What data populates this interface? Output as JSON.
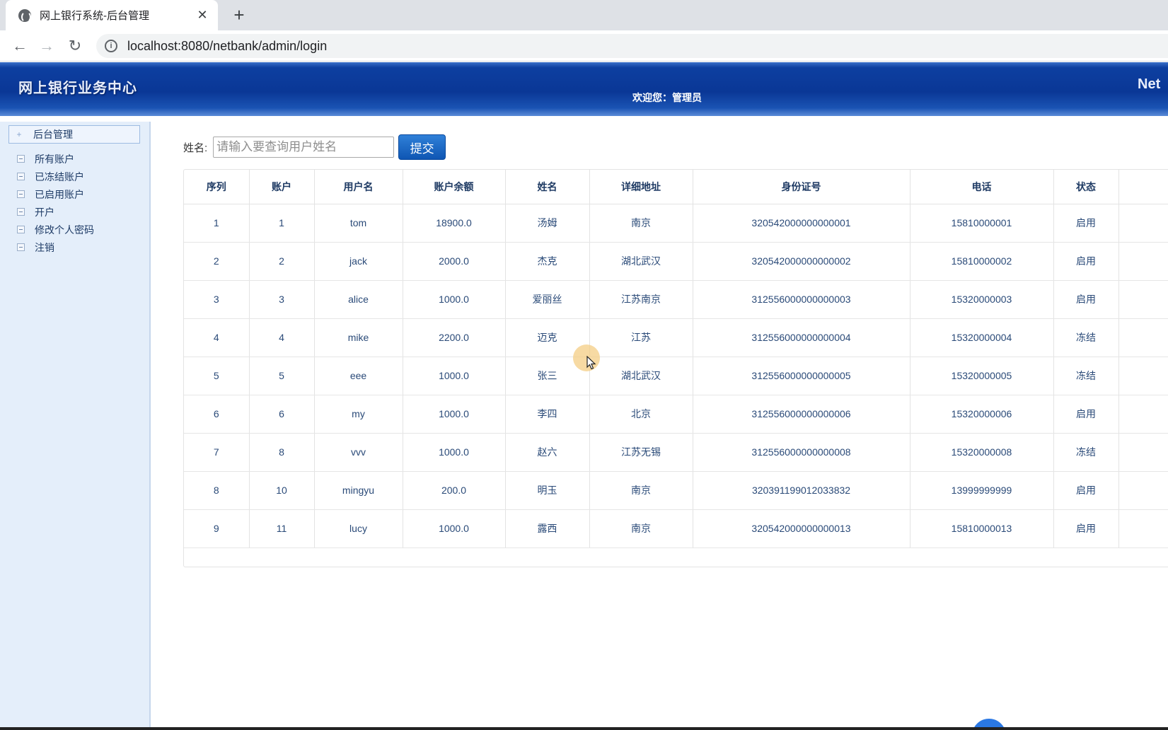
{
  "browser": {
    "tab_title": "网上银行系统-后台管理",
    "close_glyph": "✕",
    "newtab_glyph": "+",
    "url": "localhost:8080/netbank/admin/login",
    "back_glyph": "←",
    "forward_glyph": "→",
    "reload_glyph": "↻",
    "info_glyph": "i"
  },
  "header": {
    "logo": "网上银行业务中心",
    "welcome": "欢迎您：管理员",
    "right_text": "Net"
  },
  "sidebar": {
    "head_glyph": "+",
    "head_label": "后台管理",
    "items": [
      {
        "label": "所有账户"
      },
      {
        "label": "已冻结账户"
      },
      {
        "label": "已启用账户"
      },
      {
        "label": "开户"
      },
      {
        "label": "修改个人密码"
      },
      {
        "label": "注销"
      }
    ]
  },
  "search": {
    "label": "姓名:",
    "placeholder": "请输入要查询用户姓名",
    "button": "提交"
  },
  "table": {
    "headers": [
      "序列",
      "账户",
      "用户名",
      "账户余额",
      "姓名",
      "详细地址",
      "身份证号",
      "电话",
      "状态",
      ""
    ],
    "rows": [
      [
        "1",
        "1",
        "tom",
        "18900.0",
        "汤姆",
        "南京",
        "320542000000000001",
        "15810000001",
        "启用",
        ""
      ],
      [
        "2",
        "2",
        "jack",
        "2000.0",
        "杰克",
        "湖北武汉",
        "320542000000000002",
        "15810000002",
        "启用",
        ""
      ],
      [
        "3",
        "3",
        "alice",
        "1000.0",
        "爱丽丝",
        "江苏南京",
        "312556000000000003",
        "15320000003",
        "启用",
        ""
      ],
      [
        "4",
        "4",
        "mike",
        "2200.0",
        "迈克",
        "江苏",
        "312556000000000004",
        "15320000004",
        "冻结",
        ""
      ],
      [
        "5",
        "5",
        "eee",
        "1000.0",
        "张三",
        "湖北武汉",
        "312556000000000005",
        "15320000005",
        "冻结",
        ""
      ],
      [
        "6",
        "6",
        "my",
        "1000.0",
        "李四",
        "北京",
        "312556000000000006",
        "15320000006",
        "启用",
        ""
      ],
      [
        "7",
        "8",
        "vvv",
        "1000.0",
        "赵六",
        "江苏无锡",
        "312556000000000008",
        "15320000008",
        "冻结",
        ""
      ],
      [
        "8",
        "10",
        "mingyu",
        "200.0",
        "明玉",
        "南京",
        "320391199012033832",
        "13999999999",
        "启用",
        ""
      ],
      [
        "9",
        "11",
        "lucy",
        "1000.0",
        "露西",
        "南京",
        "320542000000000013",
        "15810000013",
        "启用",
        ""
      ]
    ]
  }
}
